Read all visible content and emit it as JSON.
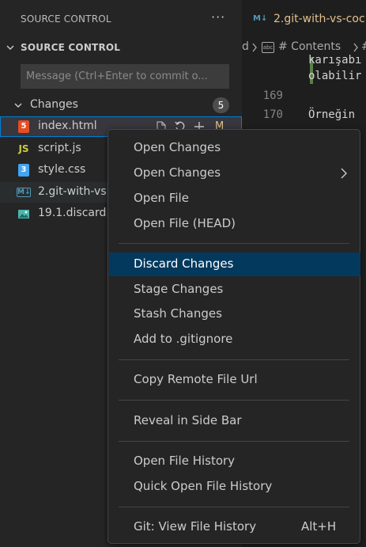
{
  "sidebar": {
    "title": "SOURCE CONTROL",
    "more_icon": "ellipsis-icon",
    "section_title": "SOURCE CONTROL",
    "commit_placeholder": "Message (Ctrl+Enter to commit o...",
    "changes_label": "Changes",
    "changes_count": "5",
    "files": [
      {
        "name": "index.html",
        "icon": "html5-icon",
        "icon_glyph": "5",
        "icon_color": "#e44d26",
        "status": "M"
      },
      {
        "name": "script.js",
        "icon": "js-icon",
        "icon_glyph": "JS",
        "icon_color": "#cbcb41",
        "status": ""
      },
      {
        "name": "style.css",
        "icon": "css3-icon",
        "icon_glyph": "3",
        "icon_color": "#42a5f5",
        "status": ""
      },
      {
        "name": "2.git-with-vs",
        "icon": "markdown-icon",
        "icon_glyph": "M↓",
        "icon_color": "#519aba",
        "status": ""
      },
      {
        "name": "19.1.discard.",
        "icon": "image-icon",
        "icon_glyph": "",
        "icon_color": "#4db6ac",
        "status": ""
      }
    ]
  },
  "editor": {
    "tab_label": "2.git-with-vs-coc",
    "tab_icon": "M↓",
    "breadcrumb": {
      "left_fragment": "d",
      "item": "# Contents",
      "right_fragment": "#"
    },
    "lines": [
      {
        "number": "",
        "text": "karışabı"
      },
      {
        "number": "",
        "text": "olabilir"
      },
      {
        "number": "169",
        "text": ""
      },
      {
        "number": "170",
        "text": "Örneğin"
      }
    ]
  },
  "context_menu": {
    "items": [
      {
        "label": "Open Changes",
        "submenu": false
      },
      {
        "label": "Open Changes",
        "submenu": true
      },
      {
        "label": "Open File",
        "submenu": false
      },
      {
        "label": "Open File (HEAD)",
        "submenu": false
      },
      {
        "label": "Discard Changes",
        "submenu": false,
        "active": true
      },
      {
        "label": "Stage Changes",
        "submenu": false
      },
      {
        "label": "Stash Changes",
        "submenu": false
      },
      {
        "label": "Add to .gitignore",
        "submenu": false
      },
      {
        "label": "Copy Remote File Url",
        "submenu": false
      },
      {
        "label": "Reveal in Side Bar",
        "submenu": false
      },
      {
        "label": "Open File History",
        "submenu": false
      },
      {
        "label": "Quick Open File History",
        "submenu": false
      },
      {
        "label": "Git: View File History",
        "submenu": false,
        "shortcut": "Alt+H"
      }
    ]
  },
  "colors": {
    "accent": "#007fd4",
    "menu_active": "#04395e",
    "modified": "#e2c08d"
  }
}
